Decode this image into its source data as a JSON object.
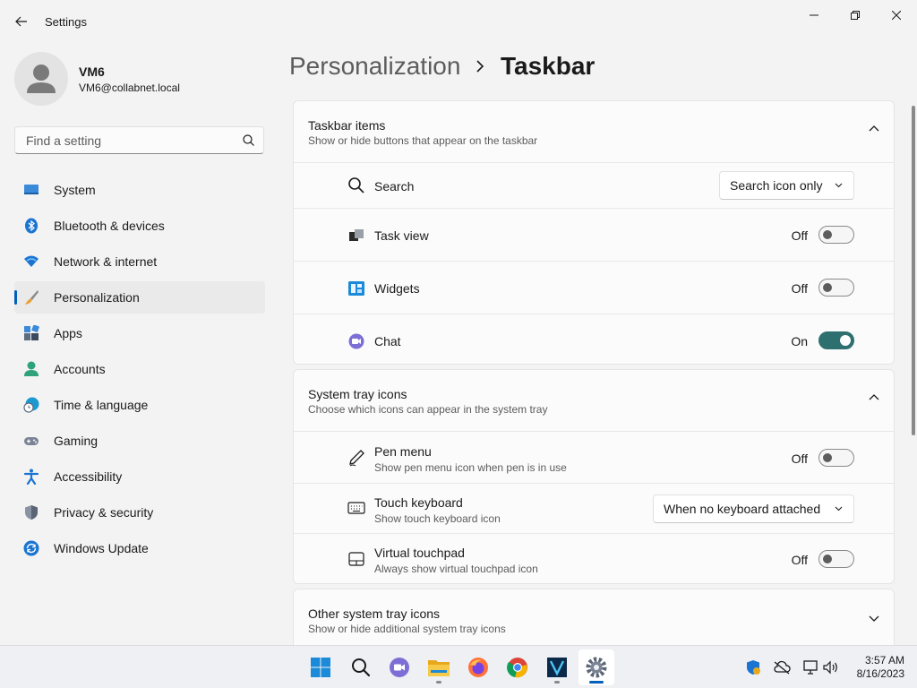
{
  "window": {
    "title": "Settings"
  },
  "user": {
    "name": "VM6",
    "email": "VM6@collabnet.local"
  },
  "search": {
    "placeholder": "Find a setting"
  },
  "nav": {
    "items": [
      {
        "label": "System",
        "icon": "system-icon"
      },
      {
        "label": "Bluetooth & devices",
        "icon": "bluetooth-icon"
      },
      {
        "label": "Network & internet",
        "icon": "wifi-icon"
      },
      {
        "label": "Personalization",
        "icon": "paintbrush-icon",
        "active": true
      },
      {
        "label": "Apps",
        "icon": "apps-icon"
      },
      {
        "label": "Accounts",
        "icon": "person-icon"
      },
      {
        "label": "Time & language",
        "icon": "globe-clock-icon"
      },
      {
        "label": "Gaming",
        "icon": "gamepad-icon"
      },
      {
        "label": "Accessibility",
        "icon": "accessibility-icon"
      },
      {
        "label": "Privacy & security",
        "icon": "shield-icon"
      },
      {
        "label": "Windows Update",
        "icon": "update-icon"
      }
    ]
  },
  "breadcrumb": {
    "parent": "Personalization",
    "current": "Taskbar"
  },
  "taskbar_items": {
    "title": "Taskbar items",
    "subtitle": "Show or hide buttons that appear on the taskbar",
    "rows": [
      {
        "label": "Search",
        "icon": "search-icon",
        "control": "dropdown",
        "value": "Search icon only"
      },
      {
        "label": "Task view",
        "icon": "task-view-icon",
        "control": "toggle",
        "state": "Off"
      },
      {
        "label": "Widgets",
        "icon": "widgets-icon",
        "control": "toggle",
        "state": "Off"
      },
      {
        "label": "Chat",
        "icon": "chat-icon",
        "control": "toggle",
        "state": "On"
      }
    ]
  },
  "system_tray": {
    "title": "System tray icons",
    "subtitle": "Choose which icons can appear in the system tray",
    "rows": [
      {
        "label": "Pen menu",
        "desc": "Show pen menu icon when pen is in use",
        "icon": "pen-icon",
        "control": "toggle",
        "state": "Off"
      },
      {
        "label": "Touch keyboard",
        "desc": "Show touch keyboard icon",
        "icon": "keyboard-icon",
        "control": "dropdown",
        "value": "When no keyboard attached"
      },
      {
        "label": "Virtual touchpad",
        "desc": "Always show virtual touchpad icon",
        "icon": "touchpad-icon",
        "control": "toggle",
        "state": "Off"
      }
    ]
  },
  "other_tray": {
    "title": "Other system tray icons",
    "subtitle": "Show or hide additional system tray icons"
  },
  "taskbar": {
    "apps": [
      "start-icon",
      "search-icon",
      "chat-icon",
      "file-explorer-icon",
      "firefox-icon",
      "chrome-icon",
      "vim-icon",
      "settings-icon"
    ],
    "time": "3:57 AM",
    "date": "8/16/2023"
  },
  "colors": {
    "accent": "#005fb8",
    "toggle_on": "#2e7070"
  }
}
